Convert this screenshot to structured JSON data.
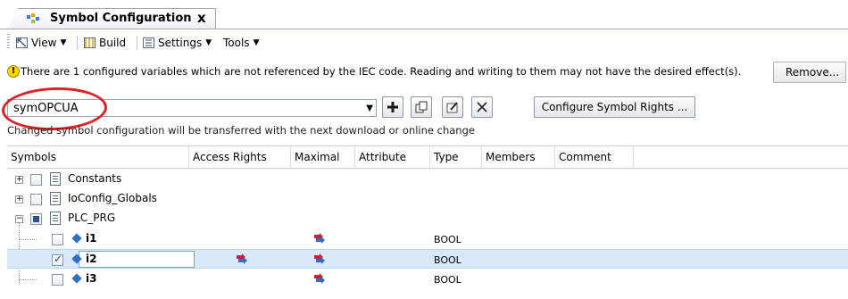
{
  "tab": {
    "title": "Symbol Configuration",
    "close_glyph": "x"
  },
  "toolbar": {
    "view_label": "View",
    "build_label": "Build",
    "settings_label": "Settings",
    "tools_label": "Tools"
  },
  "warning": {
    "icon_glyph": "!",
    "text": "There are 1 configured variables which are not referenced by the IEC code. Reading and writing to them may not have the desired effect(s).",
    "remove_label": "Remove..."
  },
  "config": {
    "selected": "symOPCUA",
    "configure_rights_label": "Configure Symbol Rights ...",
    "info_text": "Changed symbol configuration will be transferred with the next download or online change"
  },
  "columns": [
    "Symbols",
    "Access Rights",
    "Maximal",
    "Attribute",
    "Type",
    "Members",
    "Comment"
  ],
  "tree": [
    {
      "label": "Constants",
      "expander": "+",
      "checked": "none"
    },
    {
      "label": "IoConfig_Globals",
      "expander": "+",
      "checked": "none"
    },
    {
      "label": "PLC_PRG",
      "expander": "−",
      "checked": "partial"
    }
  ],
  "variables": [
    {
      "label": "i1",
      "type": "BOOL",
      "checked": false,
      "access_rights": false
    },
    {
      "label": "i2",
      "type": "BOOL",
      "checked": true,
      "access_rights": true
    },
    {
      "label": "i3",
      "type": "BOOL",
      "checked": false,
      "access_rights": false
    }
  ],
  "colors": {
    "highlight": "#e31e24",
    "selection": "#d8e9fb",
    "warning_icon": "#ffd400"
  }
}
